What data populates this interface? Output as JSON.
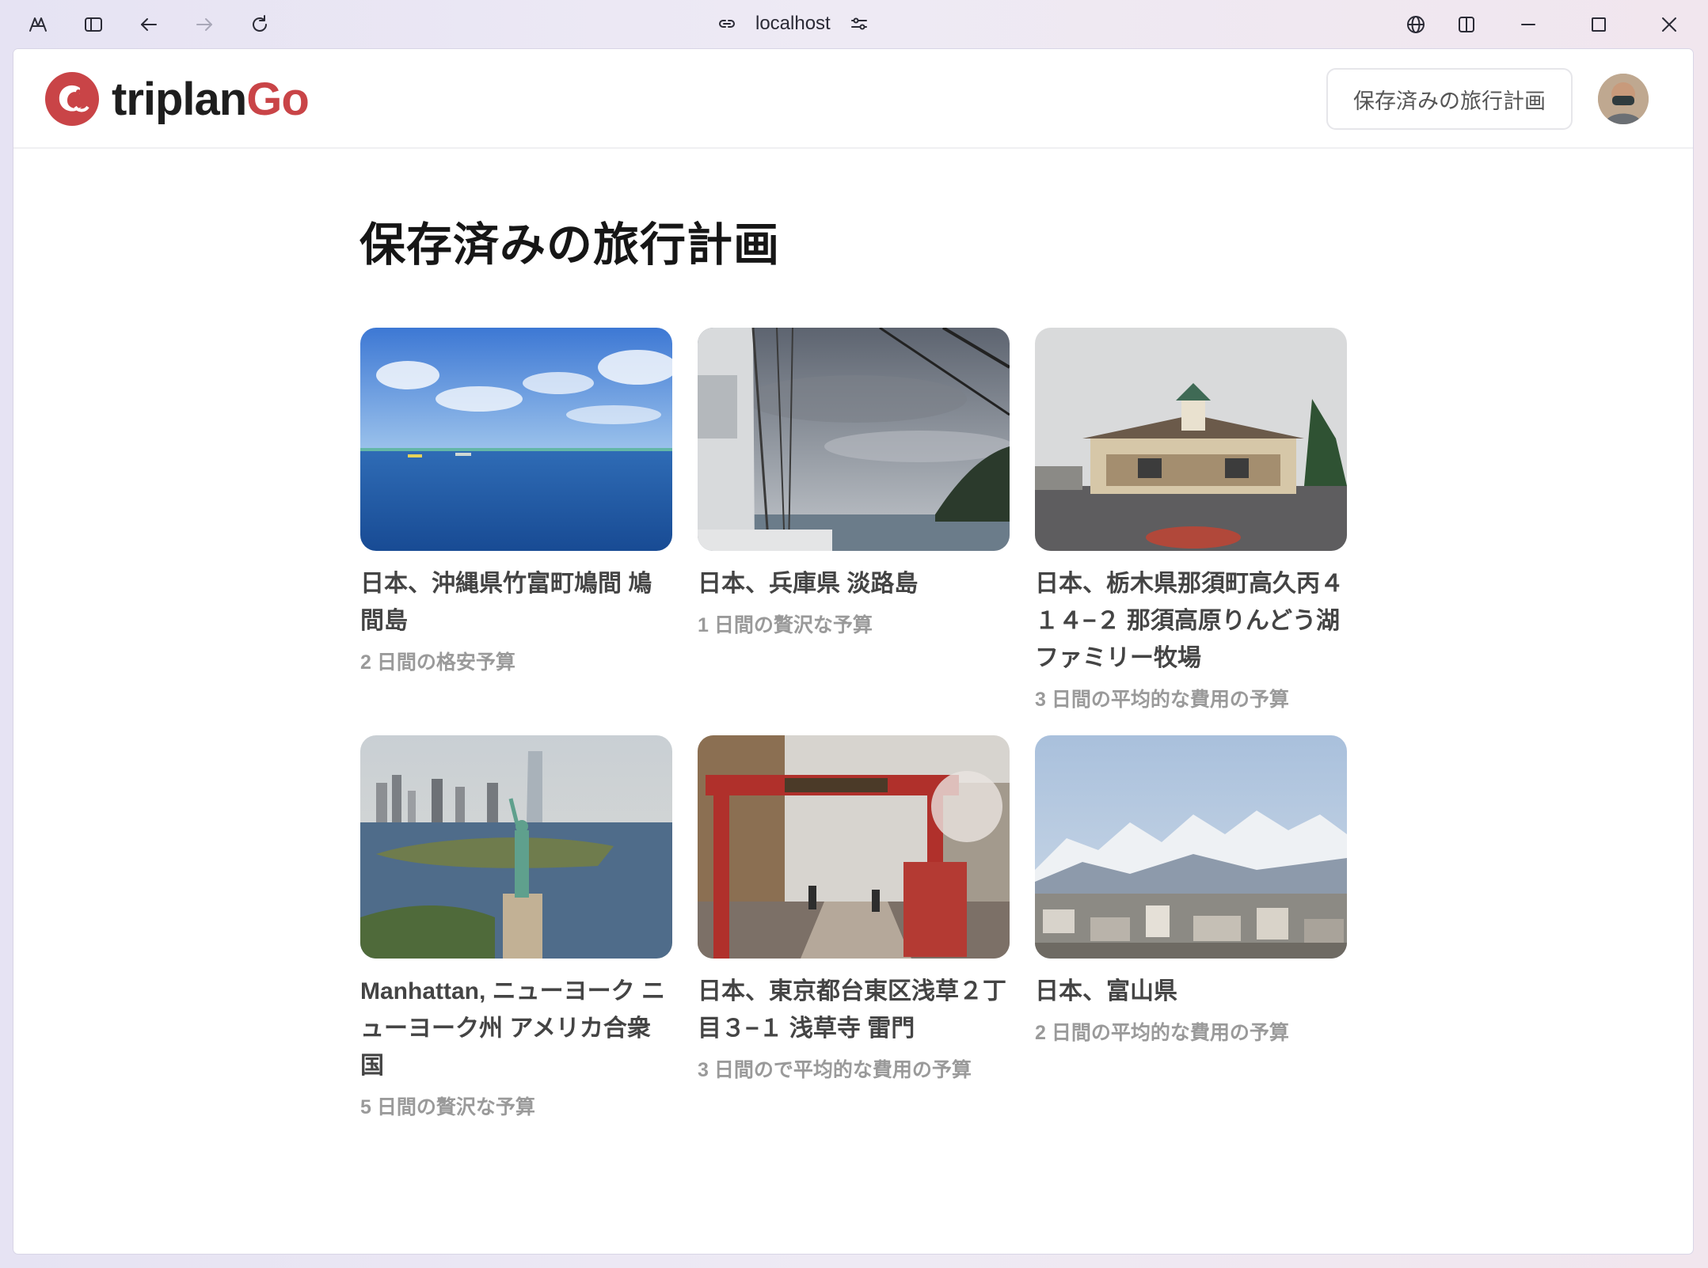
{
  "browser": {
    "url": "localhost"
  },
  "header": {
    "logo_text_a": "triplan",
    "logo_text_b": "Go",
    "saved_button_label": "保存済みの旅行計画"
  },
  "main": {
    "title": "保存済みの旅行計画",
    "cards": [
      {
        "title": "日本、沖縄県竹富町鳩間 鳩間島",
        "subtitle": "2 日間の格安予算",
        "image": "ocean-sky"
      },
      {
        "title": "日本、兵庫県 淡路島",
        "subtitle": "1 日間の贅沢な予算",
        "image": "ship-deck-cloudy-sea"
      },
      {
        "title": "日本、栃木県那須町高久丙４１４−２ 那須高原りんどう湖ファミリー牧場",
        "subtitle": "3 日間の平均的な費用の予算",
        "image": "station-building"
      },
      {
        "title": "Manhattan, ニューヨーク ニューヨーク州 アメリカ合衆国",
        "subtitle": "5 日間の贅沢な予算",
        "image": "statue-of-liberty-skyline"
      },
      {
        "title": "日本、東京都台東区浅草２丁目３−１ 浅草寺 雷門",
        "subtitle": "3 日間ので平均的な費用の予算",
        "image": "red-gate-street"
      },
      {
        "title": "日本、富山県",
        "subtitle": "2 日間の平均的な費用の予算",
        "image": "snowy-mountains-town"
      }
    ]
  },
  "colors": {
    "brand_red": "#c94447",
    "title_text": "#161616",
    "card_title": "#444444",
    "card_subtitle": "#9a9a9a"
  }
}
